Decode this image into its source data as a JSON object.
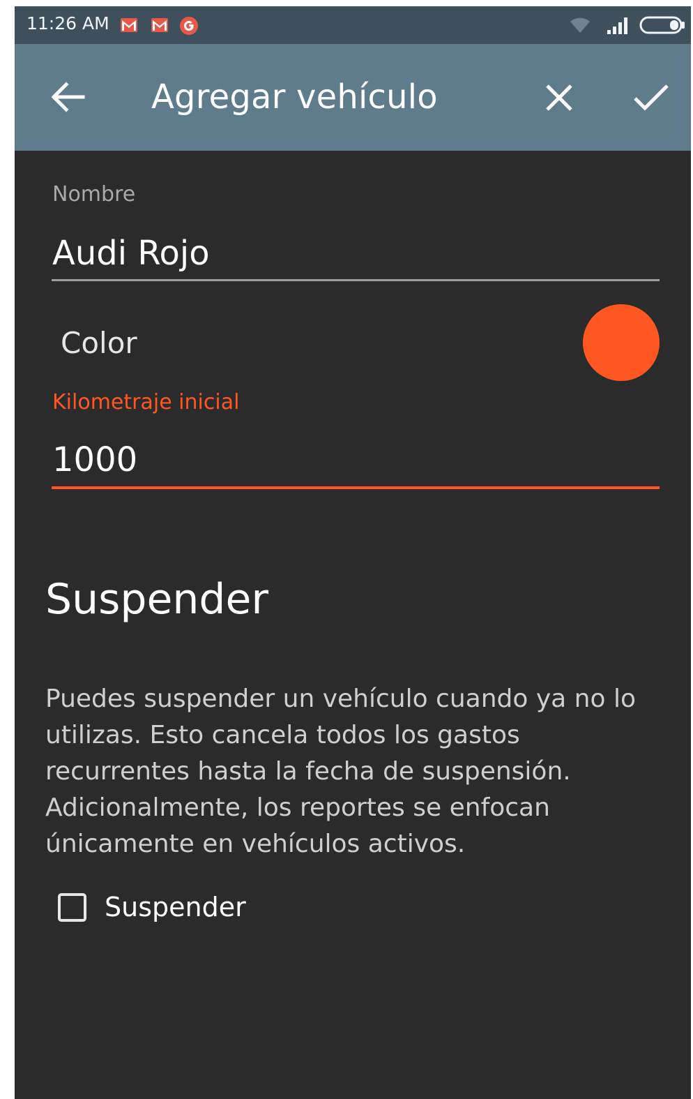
{
  "status_bar": {
    "time": "11:26 AM",
    "notification_icons": [
      "gmail-icon",
      "gmail-icon",
      "google-icon"
    ],
    "right_icons": [
      "wifi-icon",
      "signal-icon",
      "battery-icon"
    ]
  },
  "app_bar": {
    "title": "Agregar vehículo",
    "back_icon": "arrow-left-icon",
    "close_icon": "close-icon",
    "confirm_icon": "check-icon"
  },
  "form": {
    "name": {
      "label": "Nombre",
      "value": "Audi Rojo"
    },
    "color": {
      "label": "Color",
      "value": "#ff5722"
    },
    "initial_mileage": {
      "label": "Kilometraje inicial",
      "value": "1000"
    }
  },
  "suspend_section": {
    "heading": "Suspender",
    "description": "Puedes suspender un vehículo cuando ya no lo utilizas. Esto cancela todos los gastos recurrentes hasta la fecha de suspensión. Adicionalmente, los reportes se enfocan únicamente en vehículos activos.",
    "checkbox_label": "Suspender",
    "checkbox_checked": false
  },
  "colors": {
    "accent": "#ff5722",
    "app_bar": "#5f7c8c",
    "status_bar": "#3e505c",
    "background": "#2b2b2b"
  }
}
